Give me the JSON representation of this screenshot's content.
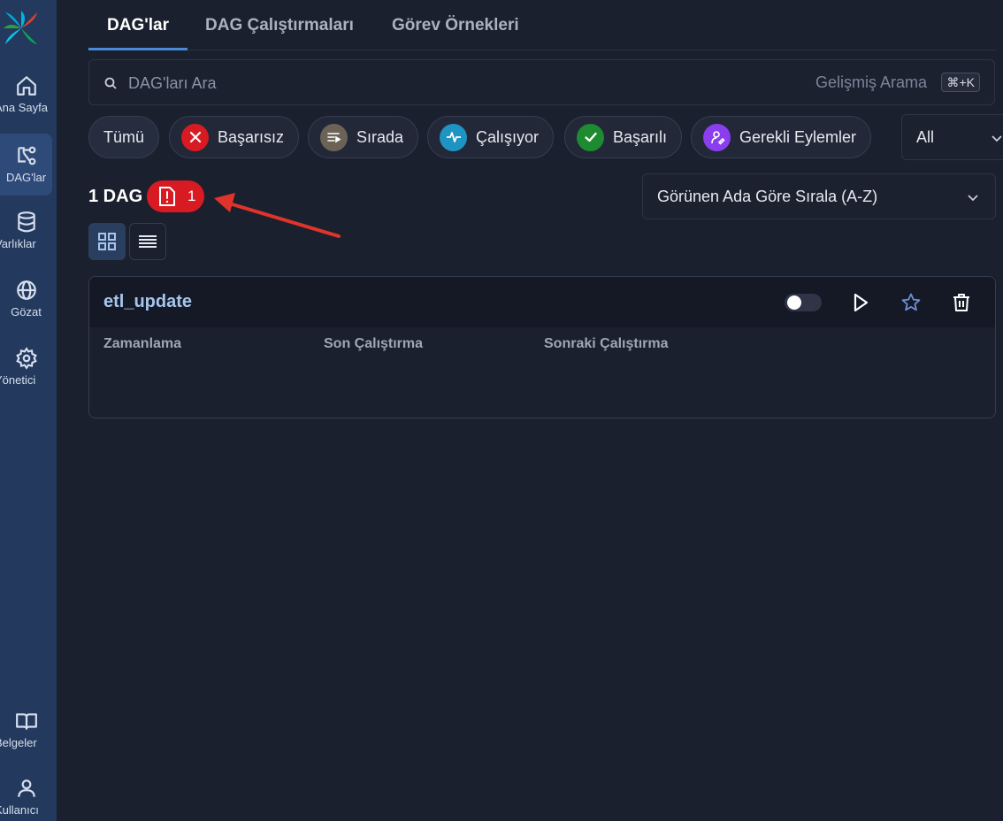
{
  "colors": {
    "accent": "#4a8ad8",
    "failed": "#d81b22",
    "queued": "#6b6356",
    "running": "#1e94c2",
    "success": "#1f8b30",
    "required": "#8a3ef0"
  },
  "sidebar": {
    "items": [
      {
        "label": "Ana Sayfa",
        "icon": "home-icon"
      },
      {
        "label": "DAG'lar",
        "icon": "dag-icon"
      },
      {
        "label": "Varlıklar",
        "icon": "database-icon"
      },
      {
        "label": "Gözat",
        "icon": "globe-icon"
      },
      {
        "label": "Yönetici",
        "icon": "gear-icon"
      },
      {
        "label": "Belgeler",
        "icon": "book-icon"
      },
      {
        "label": "Kullanıcı",
        "icon": "user-icon"
      }
    ]
  },
  "tabs": [
    {
      "label": "DAG'lar"
    },
    {
      "label": "DAG Çalıştırmaları"
    },
    {
      "label": "Görev Örnekleri"
    }
  ],
  "search": {
    "placeholder": "DAG'ları Ara",
    "advanced_label": "Gelişmiş Arama",
    "shortcut": "⌘+K"
  },
  "filters": [
    {
      "label": "Tümü"
    },
    {
      "label": "Başarısız",
      "icon": "x-circle-icon"
    },
    {
      "label": "Sırada",
      "icon": "queue-icon"
    },
    {
      "label": "Çalışıyor",
      "icon": "pulse-icon"
    },
    {
      "label": "Başarılı",
      "icon": "check-circle-icon"
    },
    {
      "label": "Gerekli Eylemler",
      "icon": "user-action-icon"
    }
  ],
  "tag_select": {
    "value": "All"
  },
  "summary": {
    "count_label": "1 DAG",
    "error_count": "1"
  },
  "sort": {
    "value": "Görünen Ada Göre Sırala (A-Z)"
  },
  "dag": {
    "name": "etl_update",
    "columns": [
      "Zamanlama",
      "Son Çalıştırma",
      "Sonraki Çalıştırma"
    ],
    "paused": true
  }
}
